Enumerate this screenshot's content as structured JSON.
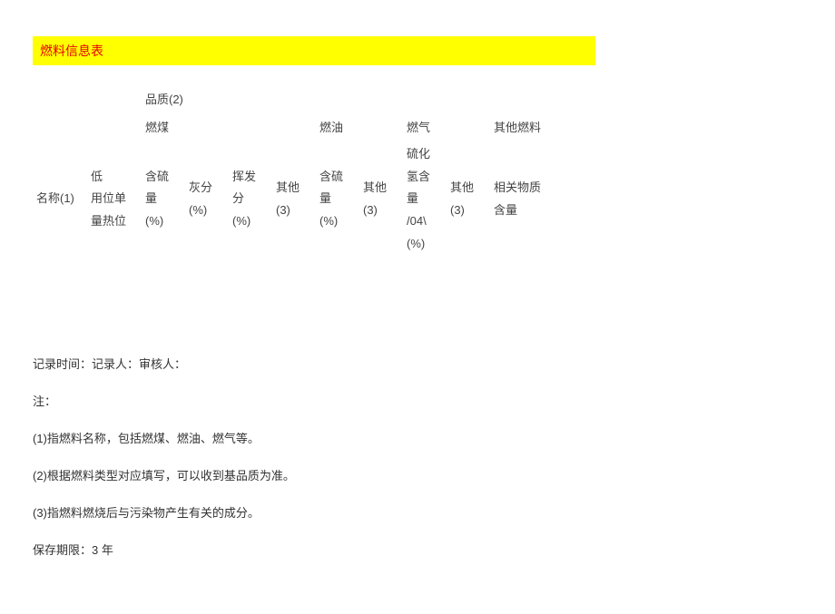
{
  "title": "燃料信息表",
  "header": {
    "quality": "品质(2)",
    "coal_group": "燃煤",
    "oil_group": "燃油",
    "gas_group": "燃气",
    "other_group": "其他燃料",
    "name_col": "名称(1)",
    "usage_block": "低\n用位单\n量热位",
    "sulfur_coal": "含硫\n量\n(%)",
    "ash": "灰分\n(%)",
    "volatile": "挥发\n分\n(%)",
    "other1": "其他\n(3)",
    "sulfur_oil": "含硫\n量\n(%)",
    "other2": "其他\n(3)",
    "h2s": "硫化\n氢含\n量\n/04\\\n(%)",
    "other3": "其他\n(3)",
    "other_fuel_sub": "相关物质\n含量"
  },
  "footer": {
    "record_line": "记录时间：记录人：审核人：",
    "note_label": "注：",
    "note1": "(1)指燃料名称，包括燃煤、燃油、燃气等。",
    "note2": "(2)根据燃料类型对应填写，可以收到基品质为准。",
    "note3": "(3)指燃料燃烧后与污染物产生有关的成分。",
    "retention": "保存期限：3 年"
  }
}
